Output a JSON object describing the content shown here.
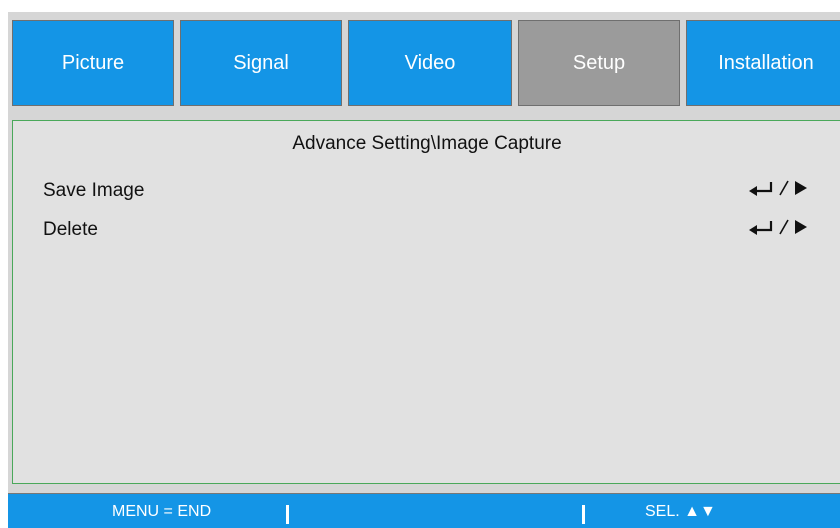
{
  "tabs": [
    {
      "label": "Picture",
      "state": "normal"
    },
    {
      "label": "Signal",
      "state": "normal"
    },
    {
      "label": "Video",
      "state": "normal"
    },
    {
      "label": "Setup",
      "state": "selected"
    },
    {
      "label": "Installation",
      "state": "normal"
    }
  ],
  "breadcrumb": "Advance Setting\\Image Capture",
  "menu_items": [
    {
      "label": "Save Image",
      "icons": [
        "enter-icon",
        "slash-separator-icon",
        "right-triangle-icon"
      ]
    },
    {
      "label": "Delete",
      "icons": [
        "enter-icon",
        "slash-separator-icon",
        "right-triangle-icon"
      ]
    }
  ],
  "status": {
    "left": "MENU = END",
    "right": "SEL. ▲▼"
  },
  "colors": {
    "tab_blue": "#1495e6",
    "tab_selected_gray": "#9b9b9b",
    "panel_background": "#d6d6d6",
    "content_background": "#e1e1e1",
    "content_border": "#4aa85a",
    "statusbar_blue": "#1495e6"
  }
}
